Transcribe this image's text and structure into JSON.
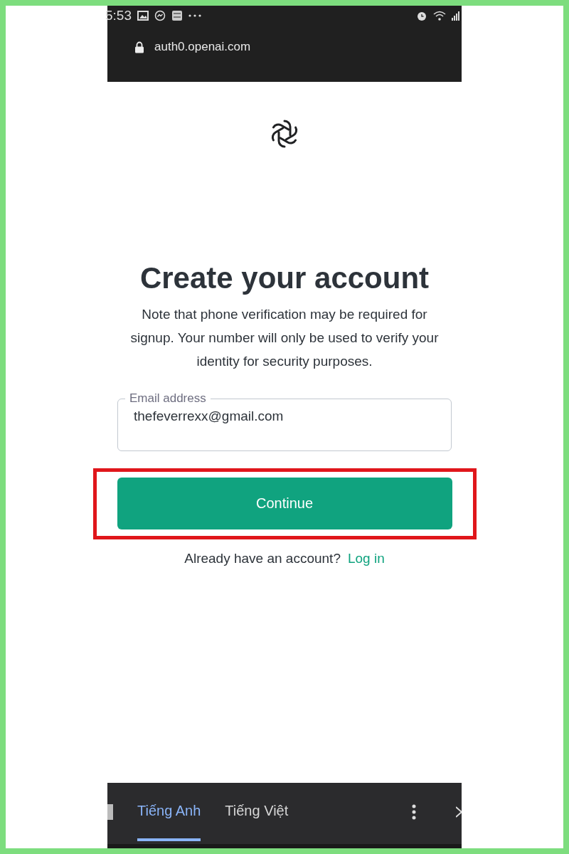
{
  "status_bar": {
    "time": "5:53"
  },
  "address_bar": {
    "url": "auth0.openai.com"
  },
  "page": {
    "heading": "Create your account",
    "note": "Note that phone verification may be required for signup. Your number will only be used to verify your identity for security purposes.",
    "email_field": {
      "label": "Email address",
      "value": "thefeverrexx@gmail.com"
    },
    "continue_button": "Continue",
    "login_prompt": "Already have an account?",
    "login_link": "Log in"
  },
  "translate_bar": {
    "tabs": [
      {
        "label": "Tiếng Anh",
        "selected": true
      },
      {
        "label": "Tiếng Việt",
        "selected": false
      }
    ]
  }
}
